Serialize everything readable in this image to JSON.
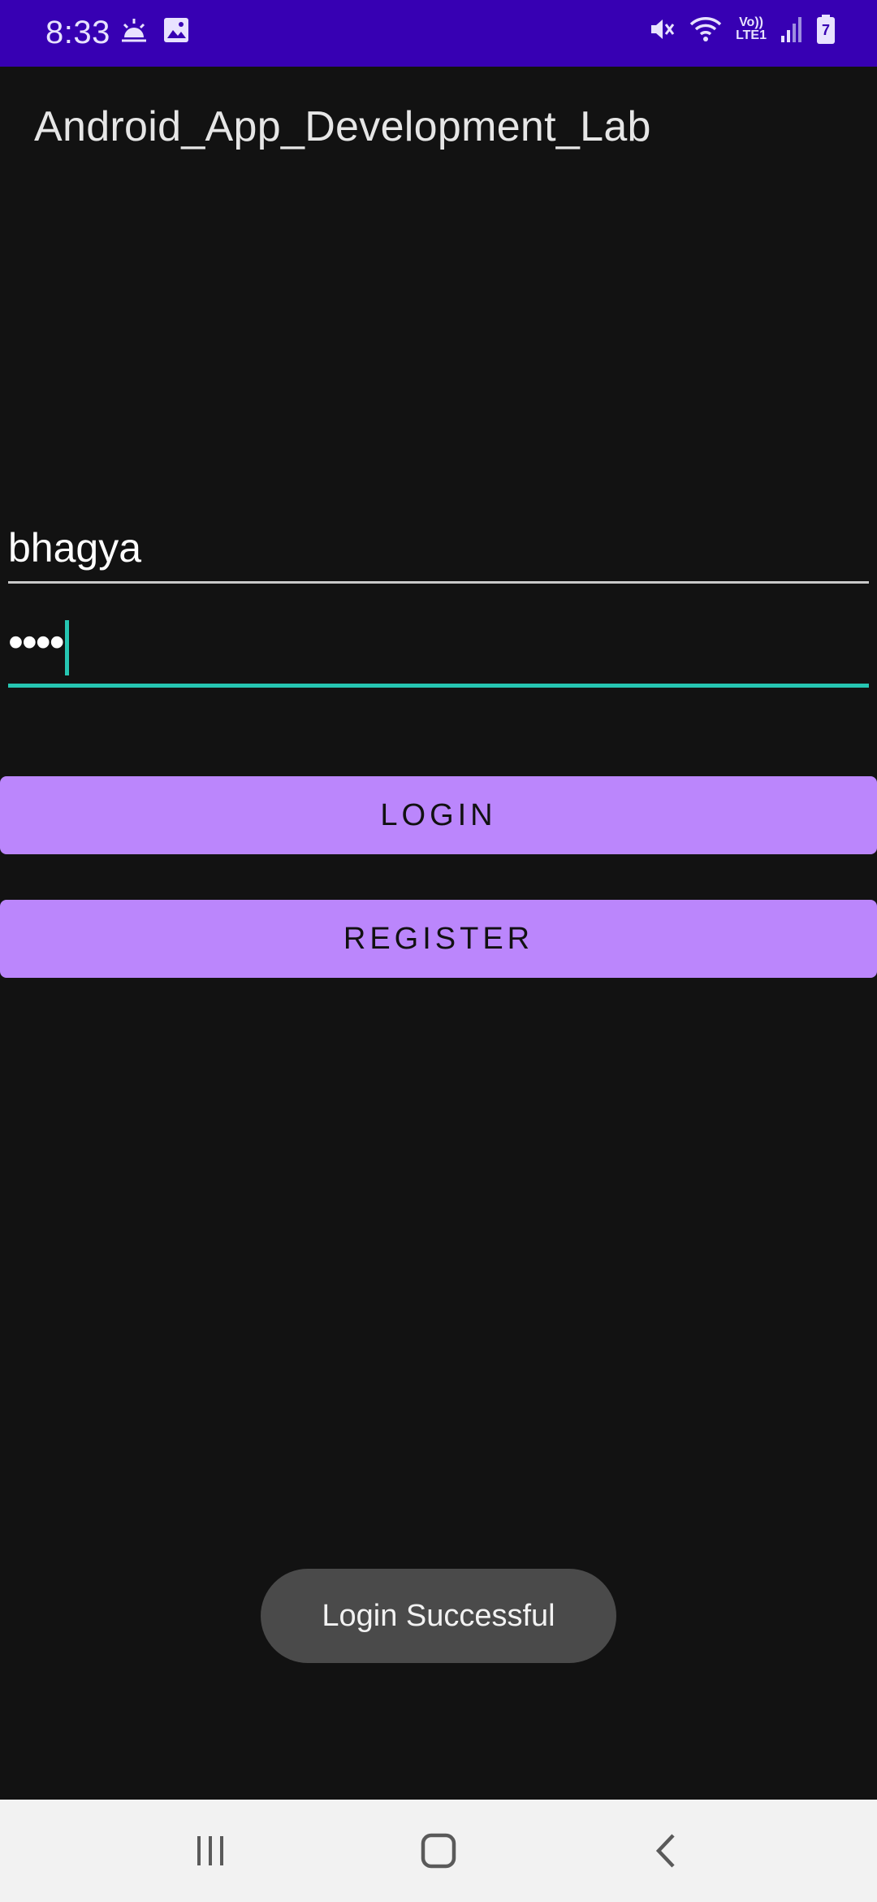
{
  "status_bar": {
    "time": "8:33",
    "left_icons": [
      "weather-sunrise-icon",
      "image-icon"
    ],
    "right_icons": [
      "mute-icon",
      "wifi-icon",
      "volte-lte1-icon",
      "signal-icon",
      "battery-charging-icon"
    ],
    "volte_label": "Vo))",
    "lte_label": "LTE1",
    "battery_level_label": "7",
    "background": "#3700b3"
  },
  "app_bar": {
    "title": "Android_App_Development_Lab"
  },
  "form": {
    "username_value": "bhagya",
    "password_value": "••••"
  },
  "buttons": {
    "login_label": "LOGIN",
    "register_label": "REGISTER",
    "color": "#bb86fc"
  },
  "toast": {
    "message": "Login Successful"
  },
  "nav_bar": {
    "items": [
      "recents-icon",
      "home-icon",
      "back-icon"
    ]
  },
  "colors": {
    "background": "#121212",
    "accent": "#26c6b2"
  }
}
